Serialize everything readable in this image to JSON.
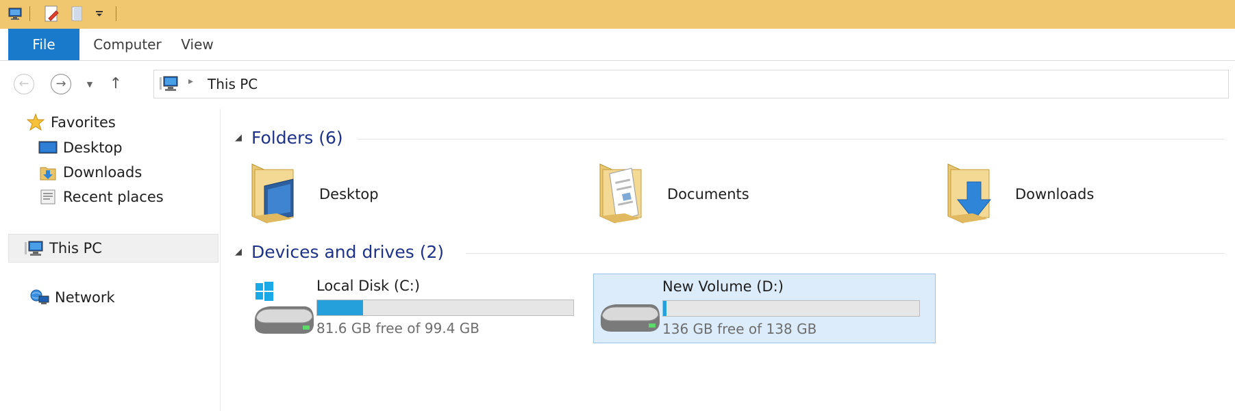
{
  "window": {
    "quick_access_icons": [
      "computer-icon",
      "properties-icon",
      "new-folder-icon",
      "customize-dropdown-icon"
    ]
  },
  "ribbon": {
    "tabs": [
      {
        "label": "File",
        "active": true
      },
      {
        "label": "Computer"
      },
      {
        "label": "View"
      }
    ]
  },
  "address": {
    "breadcrumb": "This PC",
    "icons": [
      "back-arrow-icon",
      "forward-arrow-icon",
      "recent-dropdown-icon",
      "up-arrow-icon",
      "this-pc-icon"
    ]
  },
  "nav": {
    "favorites": "Favorites",
    "desktop": "Desktop",
    "downloads": "Downloads",
    "recent": "Recent places",
    "thispc": "This PC",
    "network": "Network"
  },
  "folders": {
    "header": "Folders (6)",
    "items": [
      {
        "label": "Desktop",
        "icon": "desktop-folder-icon"
      },
      {
        "label": "Documents",
        "icon": "documents-folder-icon"
      },
      {
        "label": "Downloads",
        "icon": "downloads-folder-icon"
      }
    ]
  },
  "drives": {
    "header": "Devices and drives (2)",
    "items": [
      {
        "name": "Local Disk (C:)",
        "free": "81.6 GB free of 99.4 GB",
        "used_fraction": 0.179,
        "icon": "windows-drive-icon"
      },
      {
        "name": "New Volume (D:)",
        "free": "136 GB free of 138 GB",
        "used_fraction": 0.014,
        "icon": "hard-drive-icon",
        "selected": true
      }
    ]
  },
  "colors": {
    "titlebar": "#f0c66f",
    "file_tab": "#1979ca",
    "group_header": "#1e3287",
    "drive_bar": "#26a0da",
    "selection": "#dcecfb"
  }
}
